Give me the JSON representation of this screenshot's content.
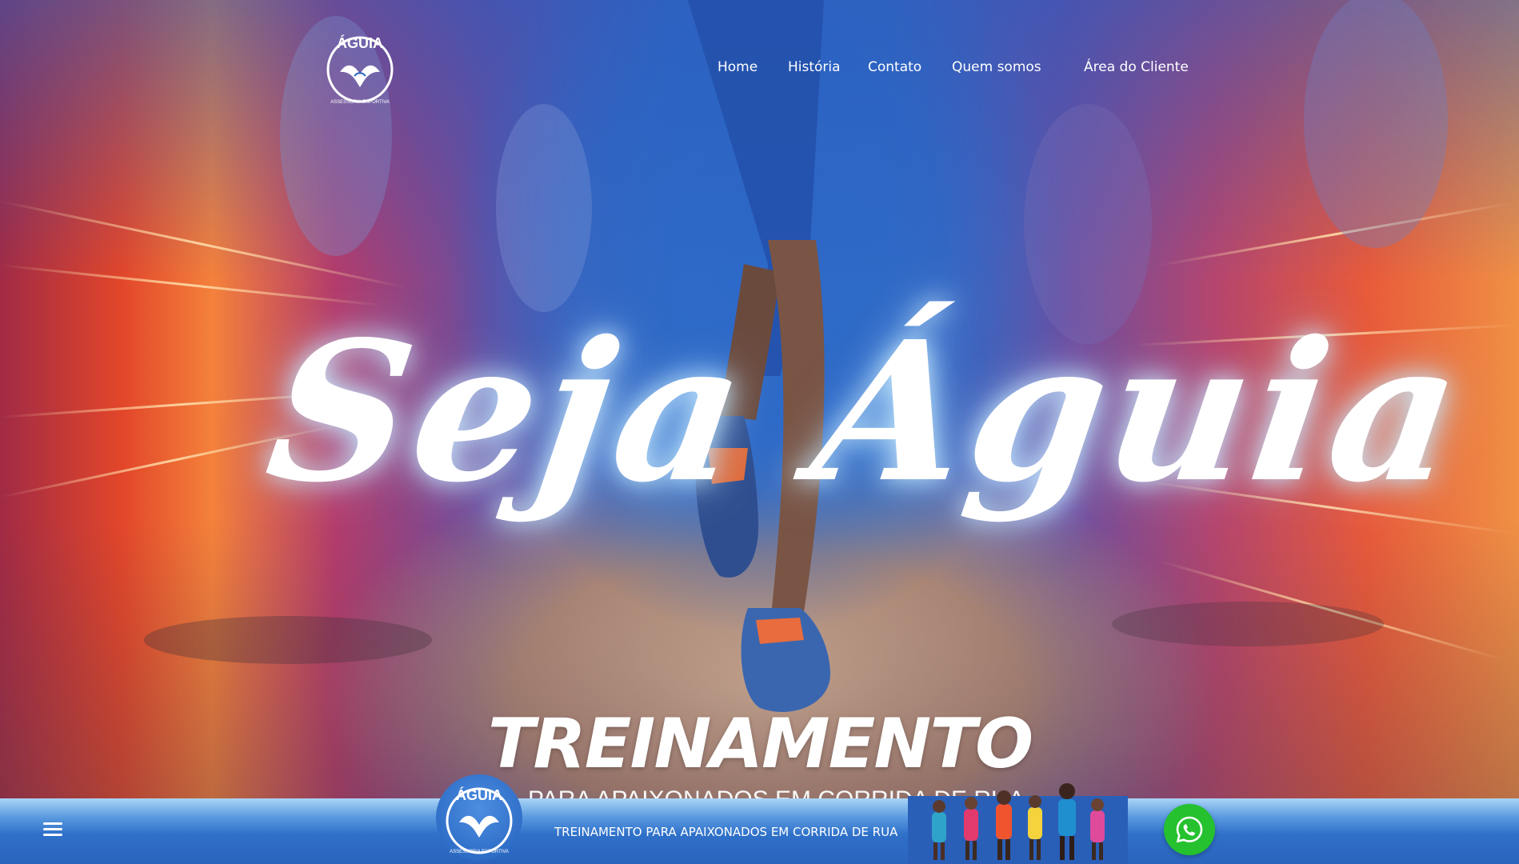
{
  "header": {
    "logo_text": "ÁGUIA",
    "logo_subtext": "ASSESSORIA ESPORTIVA"
  },
  "nav": {
    "items": [
      {
        "label": "Home"
      },
      {
        "label": "História"
      },
      {
        "label": "Contato"
      },
      {
        "label": "Quem somos"
      },
      {
        "label": "Área do Cliente"
      }
    ]
  },
  "hero": {
    "headline": "Seja Águia",
    "subhead": "TREINAMENTO",
    "tagline": "PARA APAIXONADOS EM CORRIDA DE RUA"
  },
  "bottom_bar": {
    "menu_icon": "hamburger-menu-icon",
    "logo_text": "ÁGUIA",
    "logo_subtext": "ASSESSORIA ESPORTIVA",
    "text": "TREINAMENTO PARA APAIXONADOS EM CORRIDA DE RUA",
    "whatsapp_icon": "whatsapp-icon"
  },
  "colors": {
    "brand_blue": "#2a66c0",
    "whatsapp_green": "#25c12f"
  }
}
